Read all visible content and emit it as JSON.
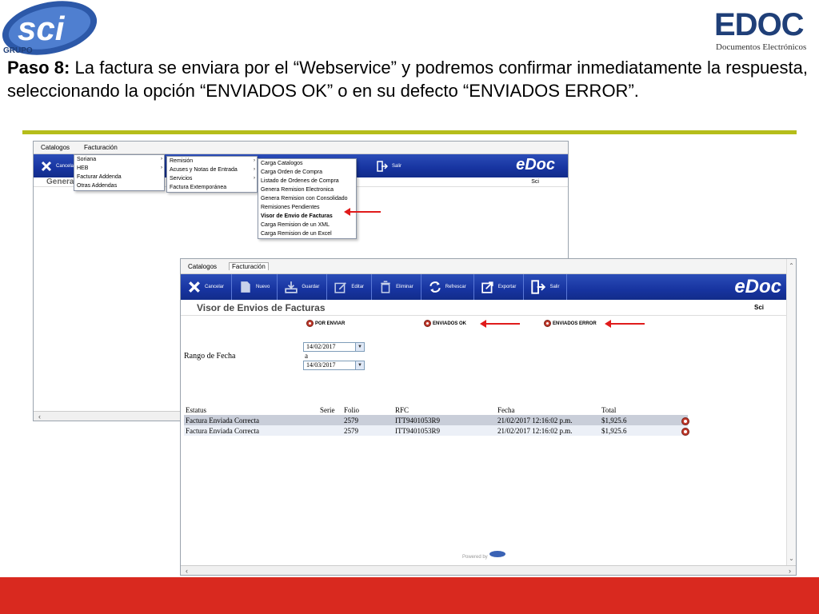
{
  "logos": {
    "sci_text": "sci",
    "sci_sub": "GRUPO",
    "edoc_text": "EDOC",
    "edoc_sub": "Documentos Electrónicos"
  },
  "instruction": {
    "step": "Paso 8:",
    "text": " La factura se enviara por el “Webservice” y podremos confirmar inmediatamente la respuesta, seleccionando la opción “ENVIADOS OK” o en su defecto “ENVIADOS ERROR”."
  },
  "back_window": {
    "menu": [
      "Catalogos",
      "Facturación"
    ],
    "toolbar": {
      "cancel": "Cancelar",
      "exit": "Salir"
    },
    "header_left": "Genera",
    "header_right": "Sci",
    "menu_level1": [
      {
        "label": "Soriana",
        "has_sub": true
      },
      {
        "label": "HEB",
        "has_sub": true
      },
      {
        "label": "Facturar Addenda",
        "has_sub": false
      },
      {
        "label": "Otras Addendas",
        "has_sub": false
      }
    ],
    "menu_level2": [
      {
        "label": "Remisión",
        "has_sub": true
      },
      {
        "label": "Acuses y Notas de Entrada",
        "has_sub": true
      },
      {
        "label": "Servicios",
        "has_sub": true
      },
      {
        "label": "Factura Extemporánea",
        "has_sub": false
      }
    ],
    "menu_level3": [
      "Carga Catalogos",
      "Carga Orden de Compra",
      "Listado de Ordenes de Compra",
      "Genera Remision Electronica",
      "Genera Remision con Consolidado",
      "Remisiones Pendientes",
      "Visor de Envio de Facturas",
      "Carga Remision de un XML",
      "Carga Remision de un Excel"
    ]
  },
  "front_window": {
    "menu": [
      "Catalogos",
      "Facturación"
    ],
    "toolbar": {
      "cancel": "Cancelar",
      "new": "Nuevo",
      "save": "Guardar",
      "edit": "Editar",
      "delete": "Eliminar",
      "refresh": "Refrescar",
      "export": "Exportar",
      "exit": "Salir"
    },
    "brand": "eDoc",
    "page_title": "Visor de Envios de Facturas",
    "user": "Sci",
    "options": {
      "por_enviar": "POR ENVIAR",
      "enviados_ok": "ENVIADOS OK",
      "enviados_error": "ENVIADOS ERROR"
    },
    "date_range": {
      "label": "Rango de Fecha",
      "from": "14/02/2017",
      "sep": "a",
      "to": "14/03/2017"
    },
    "table": {
      "headers": [
        "Estatus",
        "Serie",
        "Folio",
        "RFC",
        "Fecha",
        "Total"
      ],
      "rows": [
        [
          "Factura Enviada Correcta",
          "",
          "2579",
          "ITT9401053R9",
          "21/02/2017 12:16:02 p.m.",
          "$1,925.6"
        ],
        [
          "Factura Enviada Correcta",
          "",
          "2579",
          "ITT9401053R9",
          "21/02/2017 12:16:02 p.m.",
          "$1,925.6"
        ]
      ]
    },
    "powered_by": "Powered by"
  },
  "colors": {
    "toolbar_blue": "#1734a0",
    "accent_olive": "#b5bd1a",
    "footer_red": "#d9291f",
    "annotation_red": "#e01b1b"
  }
}
